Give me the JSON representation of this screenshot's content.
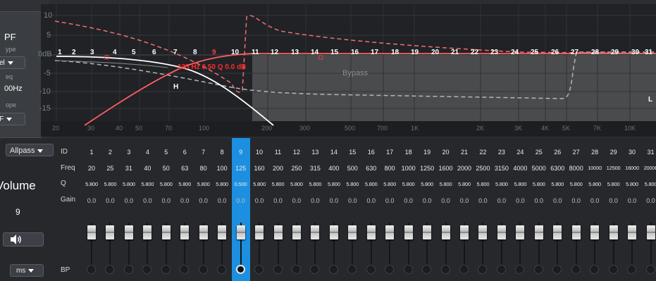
{
  "left_panel": {
    "type_label_partial": "PF",
    "type_caption_partial": "ype",
    "level_dropdown_partial": "el",
    "freq_caption_partial": "eq",
    "freq_value_partial": "00Hz",
    "slope_caption_partial": "ope",
    "slope_dropdown_partial": "F"
  },
  "graph": {
    "y_ticks": [
      "10",
      "5",
      "0dB",
      "-5",
      "-10",
      "-15"
    ],
    "x_ticks": [
      "20",
      "30",
      "40",
      "50",
      "70",
      "100",
      "200",
      "300",
      "500",
      "700",
      "1K",
      "2K",
      "3K",
      "4K",
      "5K",
      "7K",
      "10K"
    ],
    "band_marker_numbers": [
      "1",
      "2",
      "3",
      "4",
      "5",
      "6",
      "7",
      "8",
      "9",
      "10",
      "11",
      "12",
      "13",
      "14",
      "15",
      "16",
      "17",
      "18",
      "19",
      "20",
      "21",
      "22",
      "23",
      "24",
      "25",
      "26",
      "27",
      "28",
      "29",
      "30",
      "31"
    ],
    "selected_band_info": "125 Hz 0.50 Q 0.0 dB",
    "bypass_label": "Bypass",
    "marker_h": "H",
    "marker_l": "L",
    "colors": {
      "selected_curve": "#ff5a5a",
      "dashed_curve": "#f07070",
      "white_curve": "#ffffff",
      "grey_dashed": "#b0b0b0"
    }
  },
  "controls": {
    "allpass_label": "Allpass",
    "volume_label": "Volume",
    "volume_value": "9",
    "speaker_icon": "speaker-icon",
    "unit_dropdown": "ms"
  },
  "table": {
    "row_labels": {
      "id": "ID",
      "freq": "Freq",
      "q": "Q",
      "gain": "Gain",
      "bp": "BP"
    },
    "selected_id": "9",
    "selected_color": "#1d8fe0",
    "bands": [
      {
        "id": "1",
        "freq": "20",
        "q": "5.800",
        "gain": "0.0"
      },
      {
        "id": "2",
        "freq": "25",
        "q": "5.800",
        "gain": "0.0"
      },
      {
        "id": "3",
        "freq": "31",
        "q": "5.800",
        "gain": "0.0"
      },
      {
        "id": "4",
        "freq": "40",
        "q": "5.800",
        "gain": "0.0"
      },
      {
        "id": "5",
        "freq": "50",
        "q": "5.800",
        "gain": "0.0"
      },
      {
        "id": "6",
        "freq": "63",
        "q": "5.800",
        "gain": "0.0"
      },
      {
        "id": "7",
        "freq": "80",
        "q": "5.800",
        "gain": "0.0"
      },
      {
        "id": "8",
        "freq": "100",
        "q": "5.800",
        "gain": "0.0"
      },
      {
        "id": "9",
        "freq": "125",
        "q": "0.500",
        "gain": "0.0"
      },
      {
        "id": "10",
        "freq": "160",
        "q": "5.800",
        "gain": "0.0"
      },
      {
        "id": "11",
        "freq": "200",
        "q": "5.800",
        "gain": "0.0"
      },
      {
        "id": "12",
        "freq": "250",
        "q": "5.800",
        "gain": "0.0"
      },
      {
        "id": "13",
        "freq": "315",
        "q": "5.800",
        "gain": "0.0"
      },
      {
        "id": "14",
        "freq": "400",
        "q": "5.800",
        "gain": "0.0"
      },
      {
        "id": "15",
        "freq": "500",
        "q": "5.800",
        "gain": "0.0"
      },
      {
        "id": "16",
        "freq": "630",
        "q": "5.800",
        "gain": "0.0"
      },
      {
        "id": "17",
        "freq": "800",
        "q": "5.800",
        "gain": "0.0"
      },
      {
        "id": "18",
        "freq": "1000",
        "q": "5.800",
        "gain": "0.0"
      },
      {
        "id": "19",
        "freq": "1250",
        "q": "5.800",
        "gain": "0.0"
      },
      {
        "id": "20",
        "freq": "1600",
        "q": "5.800",
        "gain": "0.0"
      },
      {
        "id": "21",
        "freq": "2000",
        "q": "5.800",
        "gain": "0.0"
      },
      {
        "id": "22",
        "freq": "2500",
        "q": "5.800",
        "gain": "0.0"
      },
      {
        "id": "23",
        "freq": "3150",
        "q": "5.800",
        "gain": "0.0"
      },
      {
        "id": "24",
        "freq": "4000",
        "q": "5.800",
        "gain": "0.0"
      },
      {
        "id": "25",
        "freq": "5000",
        "q": "5.800",
        "gain": "0.0"
      },
      {
        "id": "26",
        "freq": "6300",
        "q": "5.800",
        "gain": "0.0"
      },
      {
        "id": "27",
        "freq": "8000",
        "q": "5.800",
        "gain": "0.0"
      },
      {
        "id": "28",
        "freq": "10000",
        "q": "5.800",
        "gain": "0.0"
      },
      {
        "id": "29",
        "freq": "12500",
        "q": "5.800",
        "gain": "0.0"
      },
      {
        "id": "30",
        "freq": "16000",
        "q": "5.800",
        "gain": "0.0"
      },
      {
        "id": "31",
        "freq": "20000",
        "q": "5.800",
        "gain": "0.0"
      }
    ]
  }
}
